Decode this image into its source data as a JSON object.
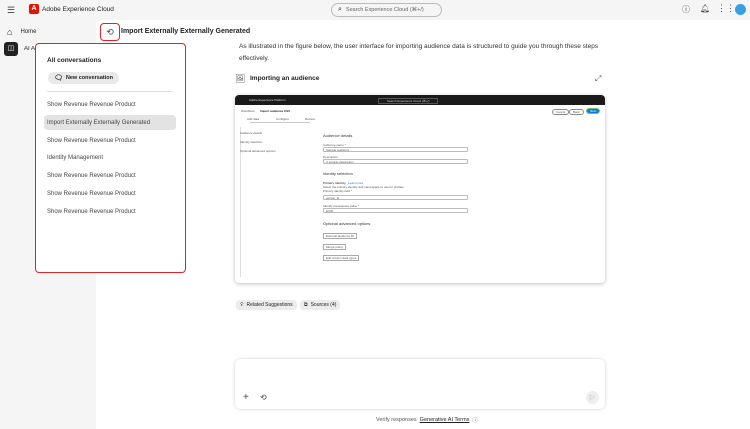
{
  "topbar": {
    "app_name": "Adobe Experience Cloud",
    "search_placeholder": "Search Experience Cloud (⌘+/)"
  },
  "sidebar": {
    "items": [
      {
        "label": "Home"
      },
      {
        "label": "AI Assistant"
      }
    ]
  },
  "header": {
    "title": "Import Externally Externally Generated"
  },
  "conversations": {
    "title": "All conversations",
    "new_label": "New conversation",
    "items": [
      "Show Revenue Revenue Product",
      "Import Externally Externally Generated",
      "Show Revenue Revenue Product",
      "Identity Management",
      "Show Revenue Revenue Product",
      "Show Revenue Revenue Product",
      "Show Revenue Revenue Product"
    ],
    "selected_index": 1
  },
  "message": {
    "text": "As illustrated in the figure below, the user interface for importing audience data is structured to guide you through these steps effectively.",
    "figure_title": "Importing an audience"
  },
  "mini": {
    "app": "Adobe Experience Platform",
    "search": "Search Experience Cloud (⌘+/)",
    "breadcrumb_root": "Workflows",
    "breadcrumb_page": "Import audience CSV",
    "steps": [
      "Add data",
      "Configure",
      "Review"
    ],
    "buttons": [
      "Cancel",
      "Back",
      "Next"
    ],
    "nav": [
      "Audience details",
      "Identity selection",
      "Optional advanced options"
    ],
    "h_details": "Audience details",
    "lbl_name": "Audience name *",
    "val_name": "Sample Audience",
    "lbl_desc": "Description",
    "val_desc": "A sample description",
    "h_identity": "Identity selection",
    "lbl_primary": "Primary identity",
    "learn_more": "Learn more",
    "primary_help": "Select the primary identity and namespace to use for profiles.",
    "lbl_field": "Primary identity field *",
    "val_field": "person_id",
    "lbl_ns": "Identity namespace value *",
    "val_ns": "ECID",
    "h_optional": "Optional advanced options",
    "opt_buttons": [
      "External audience ID",
      "Merge policy",
      "Edit column data types"
    ]
  },
  "chips": {
    "related": "Related Suggestions",
    "sources": "Sources (4)"
  },
  "footer": {
    "verify": "Verify responses",
    "terms": "Generative AI Terms"
  }
}
